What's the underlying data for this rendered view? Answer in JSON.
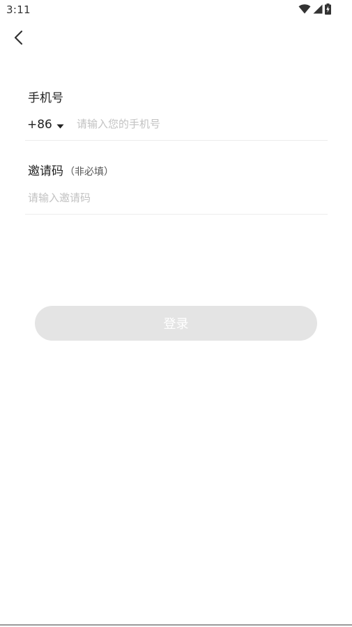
{
  "status_bar": {
    "time": "3:11",
    "icons": [
      "wifi-icon",
      "signal-icon",
      "battery-icon"
    ]
  },
  "nav": {
    "back_icon": "chevron-left-icon"
  },
  "phone": {
    "label": "手机号",
    "country_code": "+86",
    "caret_icon": "caret-down-icon",
    "placeholder": "请输入您的手机号",
    "value": ""
  },
  "invite": {
    "label": "邀请码",
    "optional_note": "（非必填）",
    "placeholder": "请输入邀请码",
    "value": ""
  },
  "login": {
    "label": "登录"
  },
  "colors": {
    "button_disabled_bg": "#e4e4e4",
    "button_text": "#ffffff",
    "placeholder": "#c2c2c2",
    "divider": "#ececec",
    "text": "#222222"
  }
}
